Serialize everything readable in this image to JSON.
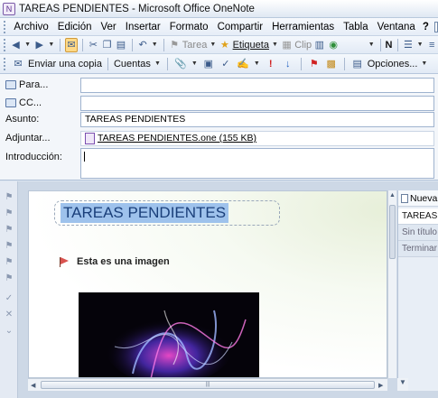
{
  "window": {
    "app_icon": "onenote-icon",
    "title": "TAREAS PENDIENTES - Microsoft Office OneNote"
  },
  "menubar": {
    "items": [
      "Archivo",
      "Edición",
      "Ver",
      "Insertar",
      "Formato",
      "Compartir",
      "Herramientas",
      "Tabla",
      "Ventana"
    ],
    "help": "?"
  },
  "toolbar1": {
    "task_label": "Tarea",
    "tag_label": "Etiqueta",
    "clip_label": "Clip",
    "bold_label": "N"
  },
  "toolbar2": {
    "send_copy_label": "Enviar una copia",
    "accounts_label": "Cuentas",
    "options_label": "Opciones..."
  },
  "fields": {
    "to_label": "Para...",
    "to_value": "",
    "cc_label": "CC...",
    "cc_value": "",
    "subject_label": "Asunto:",
    "subject_value": "TAREAS PENDIENTES",
    "attach_label": "Adjuntar...",
    "attach_value": "TAREAS PENDIENTES.one (155 KB)",
    "intro_label": "Introducción:",
    "intro_value": ""
  },
  "note": {
    "page_title": "TAREAS PENDIENTES",
    "tag_text": "Esta es una imagen",
    "image_name": "fractal-image"
  },
  "page_tabs": {
    "new_page": "Nueva",
    "pages": [
      "TAREAS P",
      "Sin título",
      "Terminar"
    ]
  },
  "colors": {
    "title_highlight": "#9ec2ec",
    "toolbar_bg": "#e2eaf5",
    "flag_red": "#d9534f"
  }
}
